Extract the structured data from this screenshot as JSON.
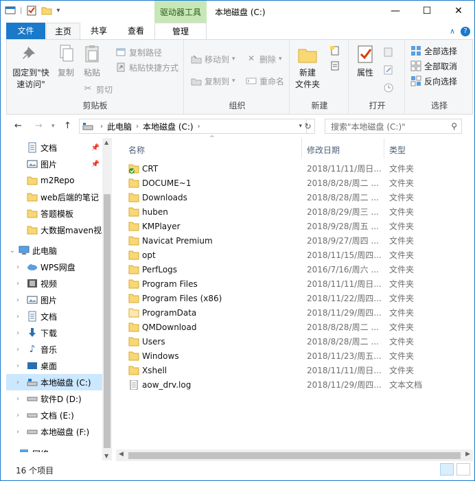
{
  "window": {
    "context_tab": "驱动器工具",
    "title": "本地磁盘 (C:)",
    "minimize": "—",
    "maximize": "☐",
    "close": "✕"
  },
  "tabs": {
    "file": "文件",
    "home": "主页",
    "share": "共享",
    "view": "查看",
    "manage": "管理"
  },
  "ribbon": {
    "clipboard": {
      "label": "剪贴板",
      "pin": "固定到\"快\n速访问\"",
      "copy": "复制",
      "paste": "粘贴",
      "copy_path": "复制路径",
      "paste_shortcut": "粘贴快捷方式",
      "cut": "剪切"
    },
    "organize": {
      "label": "组织",
      "move_to": "移动到",
      "copy_to": "复制到",
      "delete": "删除",
      "rename": "重命名"
    },
    "new": {
      "label": "新建",
      "new_folder": "新建\n文件夹"
    },
    "open": {
      "label": "打开",
      "properties": "属性"
    },
    "select": {
      "label": "选择",
      "select_all": "全部选择",
      "select_none": "全部取消",
      "invert": "反向选择"
    }
  },
  "address": {
    "crumbs": [
      "此电脑",
      "本地磁盘 (C:)"
    ],
    "search_placeholder": "搜索\"本地磁盘 (C:)\""
  },
  "nav": {
    "quick": [
      {
        "label": "文档",
        "icon": "documents-icon",
        "pinned": true
      },
      {
        "label": "图片",
        "icon": "pictures-icon",
        "pinned": true
      },
      {
        "label": "m2Repo",
        "icon": "folder-icon",
        "pinned": false
      },
      {
        "label": "web后端的笔记",
        "icon": "folder-icon",
        "pinned": false
      },
      {
        "label": "答题模板",
        "icon": "folder-icon",
        "pinned": false
      },
      {
        "label": "大数据maven视",
        "icon": "folder-icon",
        "pinned": false
      }
    ],
    "this_pc": "此电脑",
    "pc_items": [
      {
        "label": "WPS网盘",
        "icon": "cloud-icon"
      },
      {
        "label": "视频",
        "icon": "video-icon"
      },
      {
        "label": "图片",
        "icon": "pictures-icon"
      },
      {
        "label": "文档",
        "icon": "documents-icon"
      },
      {
        "label": "下载",
        "icon": "download-icon"
      },
      {
        "label": "音乐",
        "icon": "music-icon"
      },
      {
        "label": "桌面",
        "icon": "desktop-icon"
      },
      {
        "label": "本地磁盘 (C:)",
        "icon": "drive-c-icon",
        "selected": true
      },
      {
        "label": "软件D (D:)",
        "icon": "drive-icon"
      },
      {
        "label": "文档 (E:)",
        "icon": "drive-icon"
      },
      {
        "label": "本地磁盘 (F:)",
        "icon": "drive-icon"
      }
    ],
    "network": "网络"
  },
  "columns": {
    "name": "名称",
    "date": "修改日期",
    "type": "类型"
  },
  "files": [
    {
      "name": "CRT",
      "date": "2018/11/11/周日...",
      "type": "文件夹",
      "icon": "folder-synced-icon"
    },
    {
      "name": "DOCUME~1",
      "date": "2018/8/28/周二 ...",
      "type": "文件夹",
      "icon": "folder-icon"
    },
    {
      "name": "Downloads",
      "date": "2018/8/28/周二 ...",
      "type": "文件夹",
      "icon": "folder-icon"
    },
    {
      "name": "huben",
      "date": "2018/8/29/周三 ...",
      "type": "文件夹",
      "icon": "folder-icon"
    },
    {
      "name": "KMPlayer",
      "date": "2018/9/28/周五 ...",
      "type": "文件夹",
      "icon": "folder-icon"
    },
    {
      "name": "Navicat Premium",
      "date": "2018/9/27/周四 ...",
      "type": "文件夹",
      "icon": "folder-icon"
    },
    {
      "name": "opt",
      "date": "2018/11/15/周四...",
      "type": "文件夹",
      "icon": "folder-icon"
    },
    {
      "name": "PerfLogs",
      "date": "2016/7/16/周六 ...",
      "type": "文件夹",
      "icon": "folder-icon"
    },
    {
      "name": "Program Files",
      "date": "2018/11/11/周日...",
      "type": "文件夹",
      "icon": "folder-icon"
    },
    {
      "name": "Program Files (x86)",
      "date": "2018/11/22/周四...",
      "type": "文件夹",
      "icon": "folder-icon"
    },
    {
      "name": "ProgramData",
      "date": "2018/11/29/周四...",
      "type": "文件夹",
      "icon": "folder-hidden-icon"
    },
    {
      "name": "QMDownload",
      "date": "2018/8/28/周二 ...",
      "type": "文件夹",
      "icon": "folder-icon"
    },
    {
      "name": "Users",
      "date": "2018/8/28/周二 ...",
      "type": "文件夹",
      "icon": "folder-icon"
    },
    {
      "name": "Windows",
      "date": "2018/11/23/周五...",
      "type": "文件夹",
      "icon": "folder-icon"
    },
    {
      "name": "Xshell",
      "date": "2018/11/11/周日...",
      "type": "文件夹",
      "icon": "folder-icon"
    },
    {
      "name": "aow_drv.log",
      "date": "2018/11/29/周四...",
      "type": "文本文档",
      "icon": "text-file-icon"
    }
  ],
  "status": {
    "count": "16 个项目"
  },
  "colors": {
    "accent": "#1979ca",
    "folder": "#f8d775",
    "context_tab": "#c7e8b6",
    "selection": "#cce8ff"
  }
}
